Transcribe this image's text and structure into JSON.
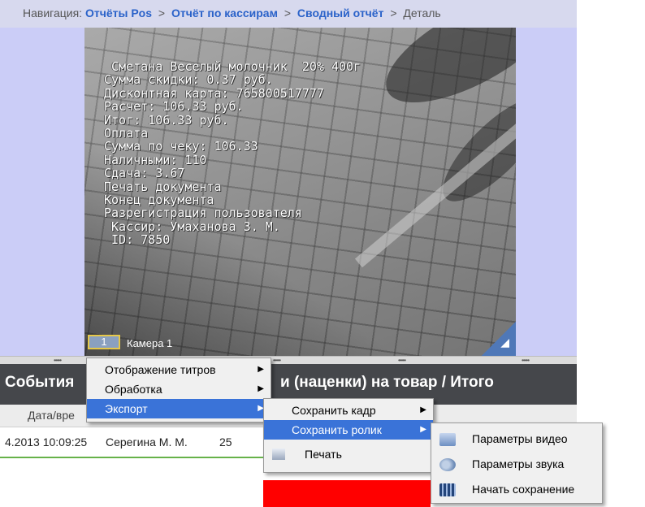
{
  "breadcrumb": {
    "prefix": "Навигация:",
    "items": [
      "Отчёты Pos",
      "Отчёт по кассирам",
      "Сводный отчёт"
    ],
    "current": "Деталь",
    "separator": ">"
  },
  "video": {
    "overlay_lines": [
      " Сметана Веселый молочник  20% 400г",
      "Сумма скидки: 0.37 руб.",
      "Дисконтная карта: 765800517777",
      "Расчет: 106.33 руб.",
      "Итог: 106.33 руб.",
      "Оплата",
      "Сумма по чеку: 106.33",
      "Наличными: 110",
      "Сдача: 3.67",
      "Печать документа",
      "Конец документа",
      "Разрегистрация пользователя",
      " Кассир: Умаханова З. М.",
      " ID: 7850"
    ],
    "camera_number": "1",
    "camera_label": "Камера 1"
  },
  "events": {
    "title_left": "События",
    "title_right": "и (наценки) на товар / Итого",
    "column_header": "Дата/вре",
    "row": {
      "datetime": "4.2013 10:09:25",
      "cashier": "Серегина М. М.",
      "value": "25"
    }
  },
  "context_menu": {
    "items": [
      {
        "label": "Отображение титров",
        "has_submenu": true
      },
      {
        "label": "Обработка",
        "has_submenu": true
      },
      {
        "label": "Экспорт",
        "has_submenu": true,
        "selected": true
      }
    ]
  },
  "export_menu": {
    "items": [
      {
        "label": "Сохранить кадр",
        "has_submenu": true
      },
      {
        "label": "Сохранить ролик",
        "has_submenu": true,
        "selected": true
      },
      {
        "label": "Печать",
        "icon": "print-icon"
      }
    ]
  },
  "save_clip_menu": {
    "items": [
      {
        "label": "Параметры видео",
        "icon": "video-settings-icon"
      },
      {
        "label": "Параметры звука",
        "icon": "sound-settings-icon"
      },
      {
        "label": "Начать сохранение",
        "icon": "film-icon"
      }
    ]
  },
  "colors": {
    "menu_highlight": "#3a73d8",
    "breadcrumb_link": "#2a62c9",
    "header_dark": "#45474b",
    "row_border": "#66b24a",
    "alert_red": "#ff0000"
  }
}
